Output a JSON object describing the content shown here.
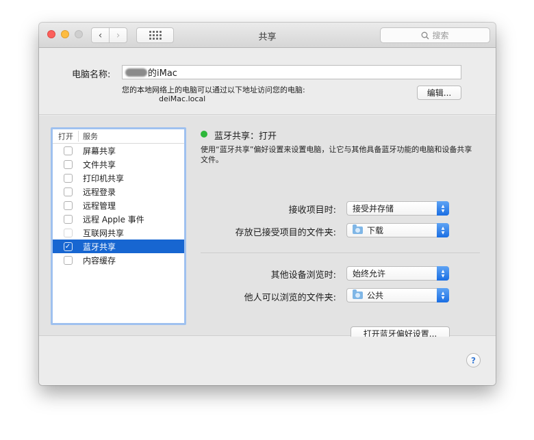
{
  "window": {
    "title": "共享"
  },
  "toolbar": {
    "back_glyph": "‹",
    "forward_glyph": "›",
    "search_placeholder": "搜索"
  },
  "computer_name": {
    "label": "电脑名称:",
    "value_suffix": "的iMac",
    "address_description": "您的本地网络上的电脑可以通过以下地址访问您的电脑:",
    "address_value": "deiMac.local",
    "edit_label": "编辑..."
  },
  "service_list": {
    "header_on": "打开",
    "header_service": "服务",
    "items": [
      {
        "label": "屏幕共享",
        "checked": false,
        "enabled": true,
        "selected": false
      },
      {
        "label": "文件共享",
        "checked": false,
        "enabled": true,
        "selected": false
      },
      {
        "label": "打印机共享",
        "checked": false,
        "enabled": true,
        "selected": false
      },
      {
        "label": "远程登录",
        "checked": false,
        "enabled": true,
        "selected": false
      },
      {
        "label": "远程管理",
        "checked": false,
        "enabled": true,
        "selected": false
      },
      {
        "label": "远程 Apple 事件",
        "checked": false,
        "enabled": true,
        "selected": false
      },
      {
        "label": "互联网共享",
        "checked": false,
        "enabled": false,
        "selected": false
      },
      {
        "label": "蓝牙共享",
        "checked": true,
        "enabled": true,
        "selected": true
      },
      {
        "label": "内容缓存",
        "checked": false,
        "enabled": true,
        "selected": false
      }
    ]
  },
  "detail": {
    "status_text": "蓝牙共享：打开",
    "status_color": "#2db73a",
    "description": "使用“蓝牙共享”偏好设置来设置电脑，让它与其他具备蓝牙功能的电脑和设备共享文件。",
    "receive_label": "接收项目时:",
    "receive_value": "接受并存储",
    "store_folder_label": "存放已接受项目的文件夹:",
    "store_folder_value": "下载",
    "browse_label": "其他设备浏览时:",
    "browse_value": "始终允许",
    "browse_folder_label": "他人可以浏览的文件夹:",
    "browse_folder_value": "公共",
    "open_bt_button": "打开蓝牙偏好设置..."
  },
  "help": {
    "glyph": "?"
  },
  "colors": {
    "selection": "#1766d1",
    "accent": "#1a6ee3",
    "list_focus_ring": "#9fc1ef"
  }
}
